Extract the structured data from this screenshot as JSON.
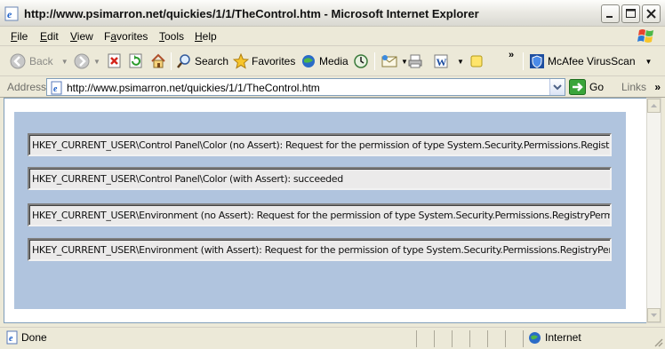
{
  "window": {
    "title": "http://www.psimarron.net/quickies/1/1/TheControl.htm - Microsoft Internet Explorer"
  },
  "menu": {
    "items": [
      {
        "accel": "F",
        "rest": "ile"
      },
      {
        "accel": "E",
        "rest": "dit"
      },
      {
        "accel": "V",
        "rest": "iew"
      },
      {
        "accel": "",
        "pre": "F",
        "accel2": "a",
        "rest": "vorites"
      },
      {
        "accel": "T",
        "rest": "ools"
      },
      {
        "accel": "H",
        "rest": "elp"
      }
    ],
    "labels": [
      "File",
      "Edit",
      "View",
      "Favorites",
      "Tools",
      "Help"
    ]
  },
  "toolbar": {
    "back_label": "Back",
    "search_label": "Search",
    "favorites_label": "Favorites",
    "media_label": "Media",
    "mcafee_label": "McAfee VirusScan",
    "overflow_label": "»"
  },
  "address": {
    "label": "Address",
    "url": "http://www.psimarron.net/quickies/1/1/TheControl.htm",
    "go_label": "Go",
    "links_label": "Links",
    "links_overflow": "»"
  },
  "content": {
    "results": [
      "HKEY_CURRENT_USER\\Control Panel\\Color (no Assert): Request for the permission of type System.Security.Permissions.RegistryPermission, mscorlib",
      "HKEY_CURRENT_USER\\Control Panel\\Color (with Assert): succeeded",
      "HKEY_CURRENT_USER\\Environment (no Assert): Request for the permission of type System.Security.Permissions.RegistryPermission, mscorlib",
      "HKEY_CURRENT_USER\\Environment (with Assert): Request for the permission of type System.Security.Permissions.RegistryPermission, mscorlib"
    ]
  },
  "status": {
    "text": "Done",
    "zone": "Internet"
  },
  "colors": {
    "panel": "#b0c4de",
    "xp_blue": "#0a246a"
  }
}
